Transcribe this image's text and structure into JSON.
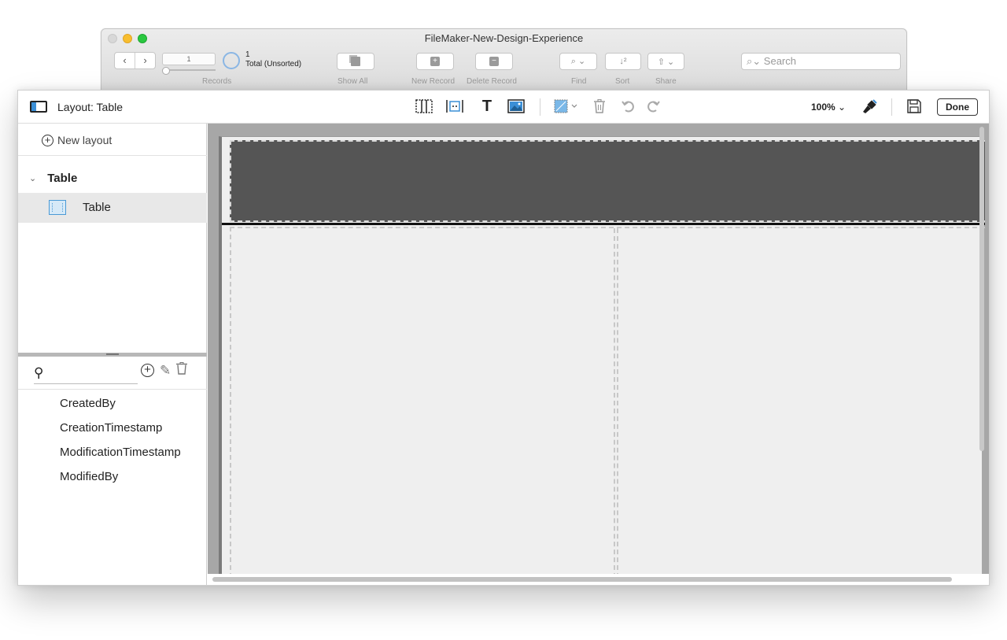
{
  "back_window": {
    "title": "FileMaker-New-Design-Experience",
    "record_field_value": "1",
    "record_count": "1",
    "record_status": "Total (Unsorted)",
    "labels": {
      "records": "Records",
      "show_all": "Show All",
      "new_record": "New Record",
      "delete_record": "Delete Record",
      "find": "Find",
      "sort": "Sort",
      "share": "Share"
    },
    "search_placeholder": "Search"
  },
  "layout_bar": {
    "title": "Layout: Table",
    "zoom": "100%",
    "done_label": "Done"
  },
  "sidebar": {
    "new_layout_label": "New layout",
    "group_label": "Table",
    "layout_items": [
      {
        "label": "Table",
        "selected": true
      }
    ],
    "fields": [
      "CreatedBy",
      "CreationTimestamp",
      "ModificationTimestamp",
      "ModifiedBy"
    ]
  },
  "colors": {
    "accent_blue": "#3b8fd6",
    "header_part": "#555555",
    "canvas_background": "#a7a7a7",
    "traffic_yellow": "#f8be2f",
    "traffic_green": "#2ac840"
  },
  "icons": {
    "layout_tools": [
      "field-tool-icon",
      "portal-tool-icon",
      "text-tool-icon",
      "image-tool-icon"
    ],
    "edit_tools": [
      "fill-color-icon",
      "trash-icon",
      "undo-icon",
      "redo-icon"
    ],
    "right_tools": [
      "format-painter-icon",
      "save-icon"
    ]
  }
}
